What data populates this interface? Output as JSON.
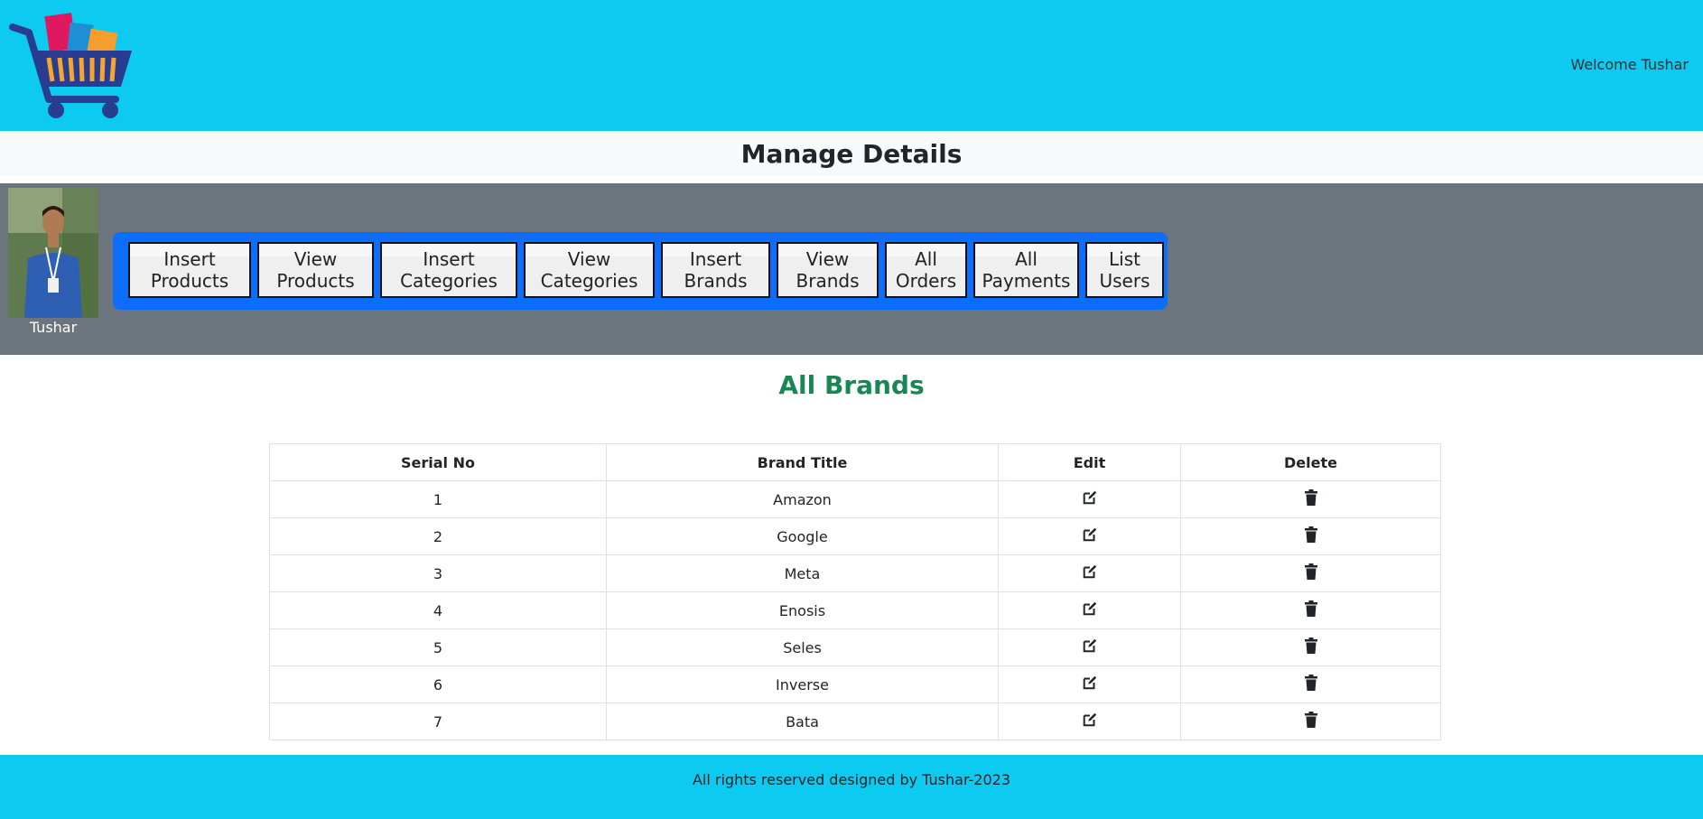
{
  "header": {
    "welcome_text": "Welcome Tushar",
    "logo_icon": "shopping-cart-logo-icon"
  },
  "page_title": "Manage Details",
  "admin": {
    "name": "Tushar",
    "nav": [
      {
        "label": "Insert Products"
      },
      {
        "label": "View Products"
      },
      {
        "label": "Insert Categories"
      },
      {
        "label": "View Categories"
      },
      {
        "label": "Insert Brands"
      },
      {
        "label": "View Brands"
      },
      {
        "label": "All Orders"
      },
      {
        "label": "All Payments"
      },
      {
        "label": "List Users"
      }
    ]
  },
  "brands_section": {
    "title": "All Brands",
    "columns": [
      "Serial No",
      "Brand Title",
      "Edit",
      "Delete"
    ],
    "rows": [
      {
        "serial": "1",
        "title": "Amazon"
      },
      {
        "serial": "2",
        "title": "Google"
      },
      {
        "serial": "3",
        "title": "Meta"
      },
      {
        "serial": "4",
        "title": "Enosis"
      },
      {
        "serial": "5",
        "title": "Seles"
      },
      {
        "serial": "6",
        "title": "Inverse"
      },
      {
        "serial": "7",
        "title": "Bata"
      }
    ],
    "edit_icon": "edit-icon",
    "delete_icon": "trash-icon"
  },
  "footer": {
    "text": "All rights reserved designed by Tushar-2023"
  },
  "colors": {
    "header_bg": "#0dcaf0",
    "admin_bg": "#6c757d",
    "nav_bg": "#0d6efd",
    "section_title": "#198754"
  }
}
